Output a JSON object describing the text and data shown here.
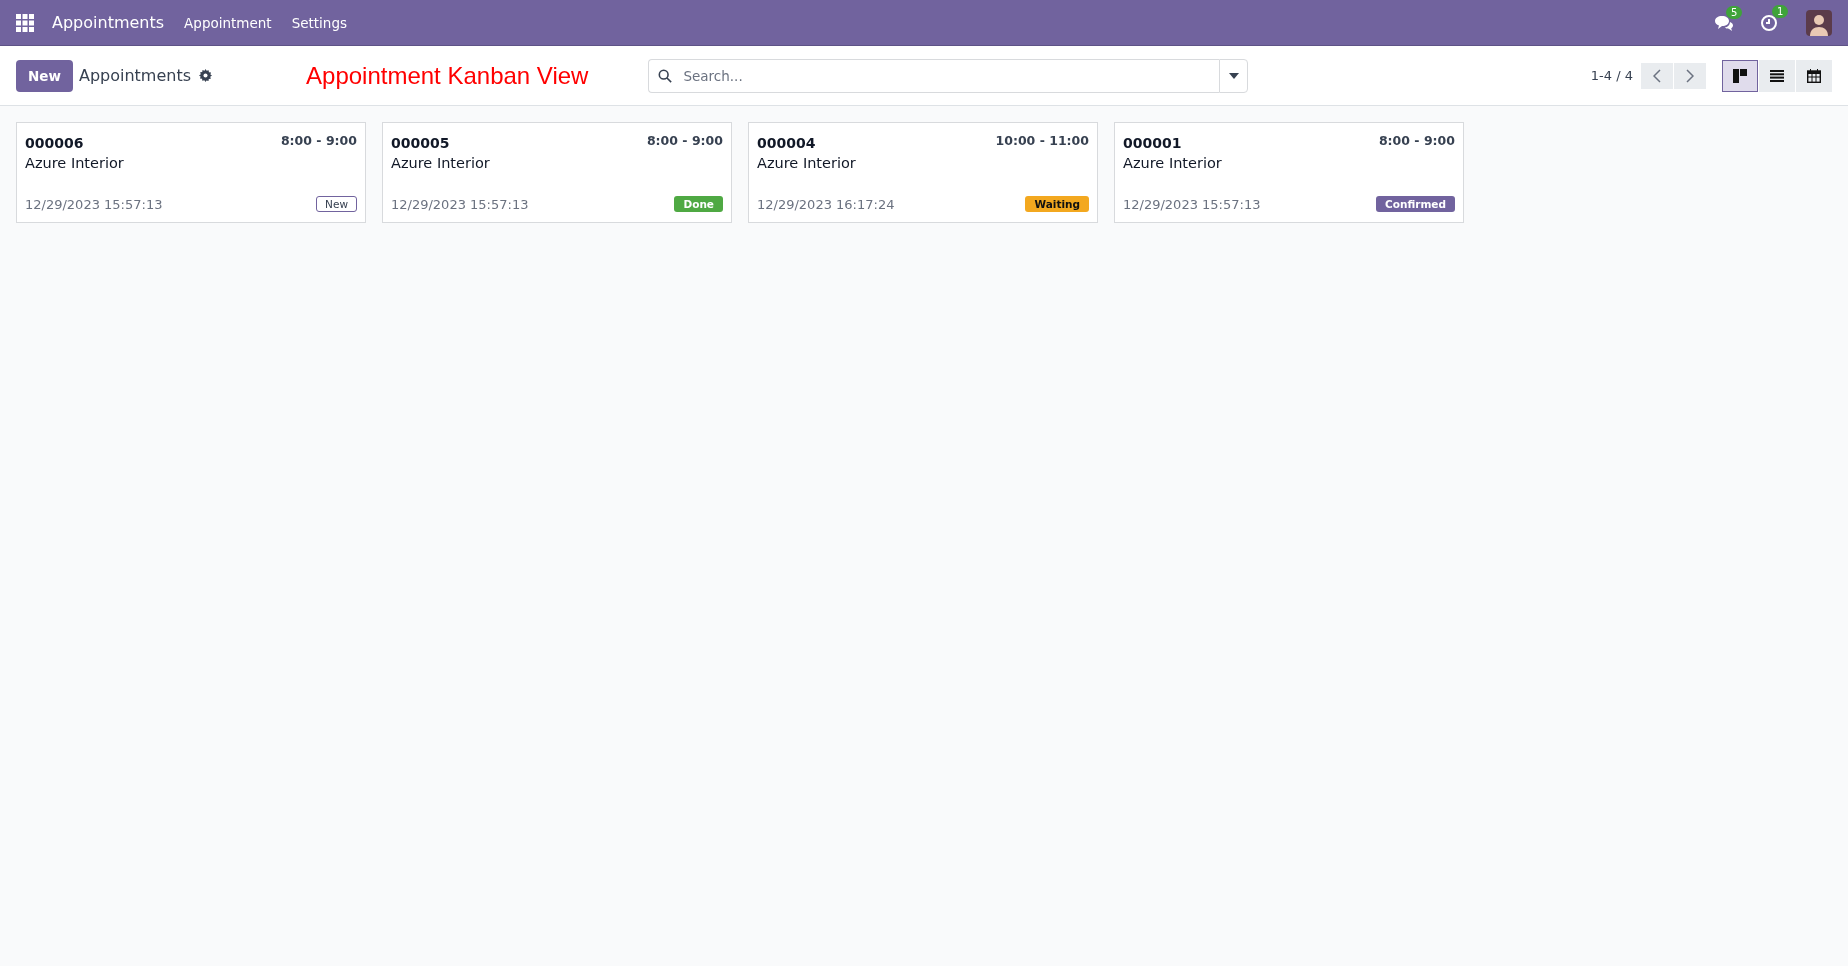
{
  "navbar": {
    "app_name": "Appointments",
    "menu": [
      "Appointment",
      "Settings"
    ],
    "messages_count": "5",
    "activities_count": "1"
  },
  "control_panel": {
    "new_button": "New",
    "breadcrumb": "Appointments",
    "annotation": "Appointment Kanban View",
    "search": {
      "placeholder": "Search..."
    },
    "pager": "1-4 / 4",
    "views": [
      {
        "kind": "kanban",
        "selected": true
      },
      {
        "kind": "list",
        "selected": false
      },
      {
        "kind": "calendar",
        "selected": false
      }
    ]
  },
  "cards": [
    {
      "ref": "000006",
      "time": "8:00 - 9:00",
      "customer": "Azure Interior",
      "date": "12/29/2023 15:57:13",
      "status": {
        "label": "New",
        "kind": "new"
      }
    },
    {
      "ref": "000005",
      "time": "8:00 - 9:00",
      "customer": "Azure Interior",
      "date": "12/29/2023 15:57:13",
      "status": {
        "label": "Done",
        "kind": "done"
      }
    },
    {
      "ref": "000004",
      "time": "10:00 - 11:00",
      "customer": "Azure Interior",
      "date": "12/29/2023 16:17:24",
      "status": {
        "label": "Waiting",
        "kind": "waiting"
      }
    },
    {
      "ref": "000001",
      "time": "8:00 - 9:00",
      "customer": "Azure Interior",
      "date": "12/29/2023 15:57:13",
      "status": {
        "label": "Confirmed",
        "kind": "confirmed"
      }
    }
  ]
}
